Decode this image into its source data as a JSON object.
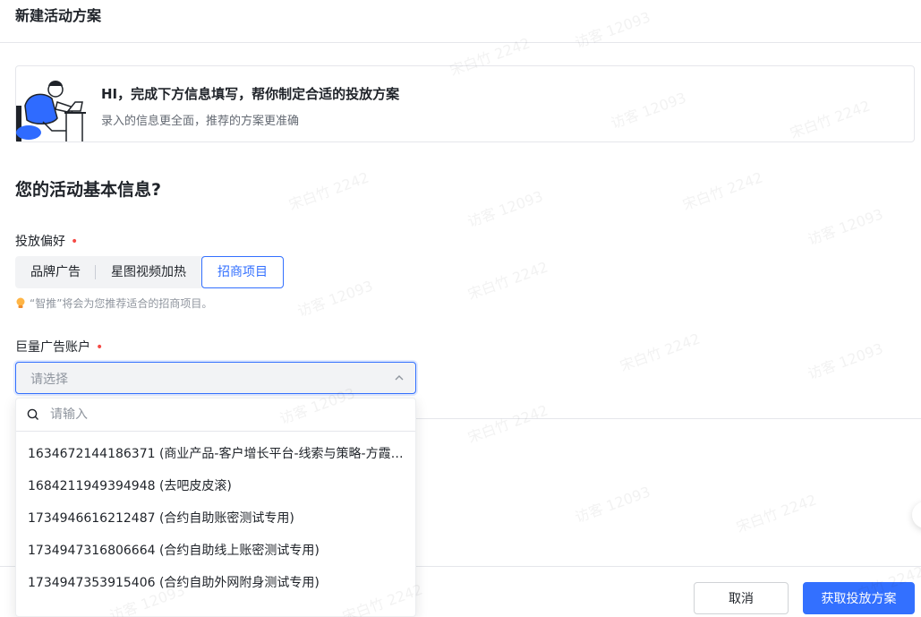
{
  "header": {
    "title": "新建活动方案"
  },
  "banner": {
    "title": "HI，完成下方信息填写，帮你制定合适的投放方案",
    "subtitle": "录入的信息更全面，推荐的方案更准确"
  },
  "section": {
    "title": "您的活动基本信息?"
  },
  "preference": {
    "label": "投放偏好",
    "required_mark": "•",
    "options": [
      "品牌广告",
      "星图视频加热",
      "招商项目"
    ],
    "selected": "招商项目",
    "hint": "“智推”将会为您推荐适合的招商项目。"
  },
  "account": {
    "label": "巨量广告账户",
    "required_mark": "•",
    "placeholder": "请选择"
  },
  "dropdown": {
    "search_placeholder": "请输入",
    "items": [
      "1634672144186371 (商业产品-客户增长平台-线索与策略-方霞…",
      "1684211949394948 (去吧皮皮滚)",
      "1734946616212487 (合约自助账密测试专用)",
      "1734947316806664 (合约自助线上账密测试专用)",
      "1734947353915406 (合约自助外网附身测试专用)"
    ]
  },
  "footer": {
    "cancel_label": "取消",
    "submit_label": "获取投放方案"
  },
  "watermark": {
    "lines": [
      "宋白竹 2242",
      "访客 12093"
    ]
  },
  "colors": {
    "accent": "#3370ff",
    "required": "#f54a45",
    "text": "#1f2329",
    "muted": "#8f959e"
  },
  "icons": {
    "bulb": "lightbulb-icon",
    "search": "search-icon",
    "chevron": "chevron-up-icon"
  }
}
